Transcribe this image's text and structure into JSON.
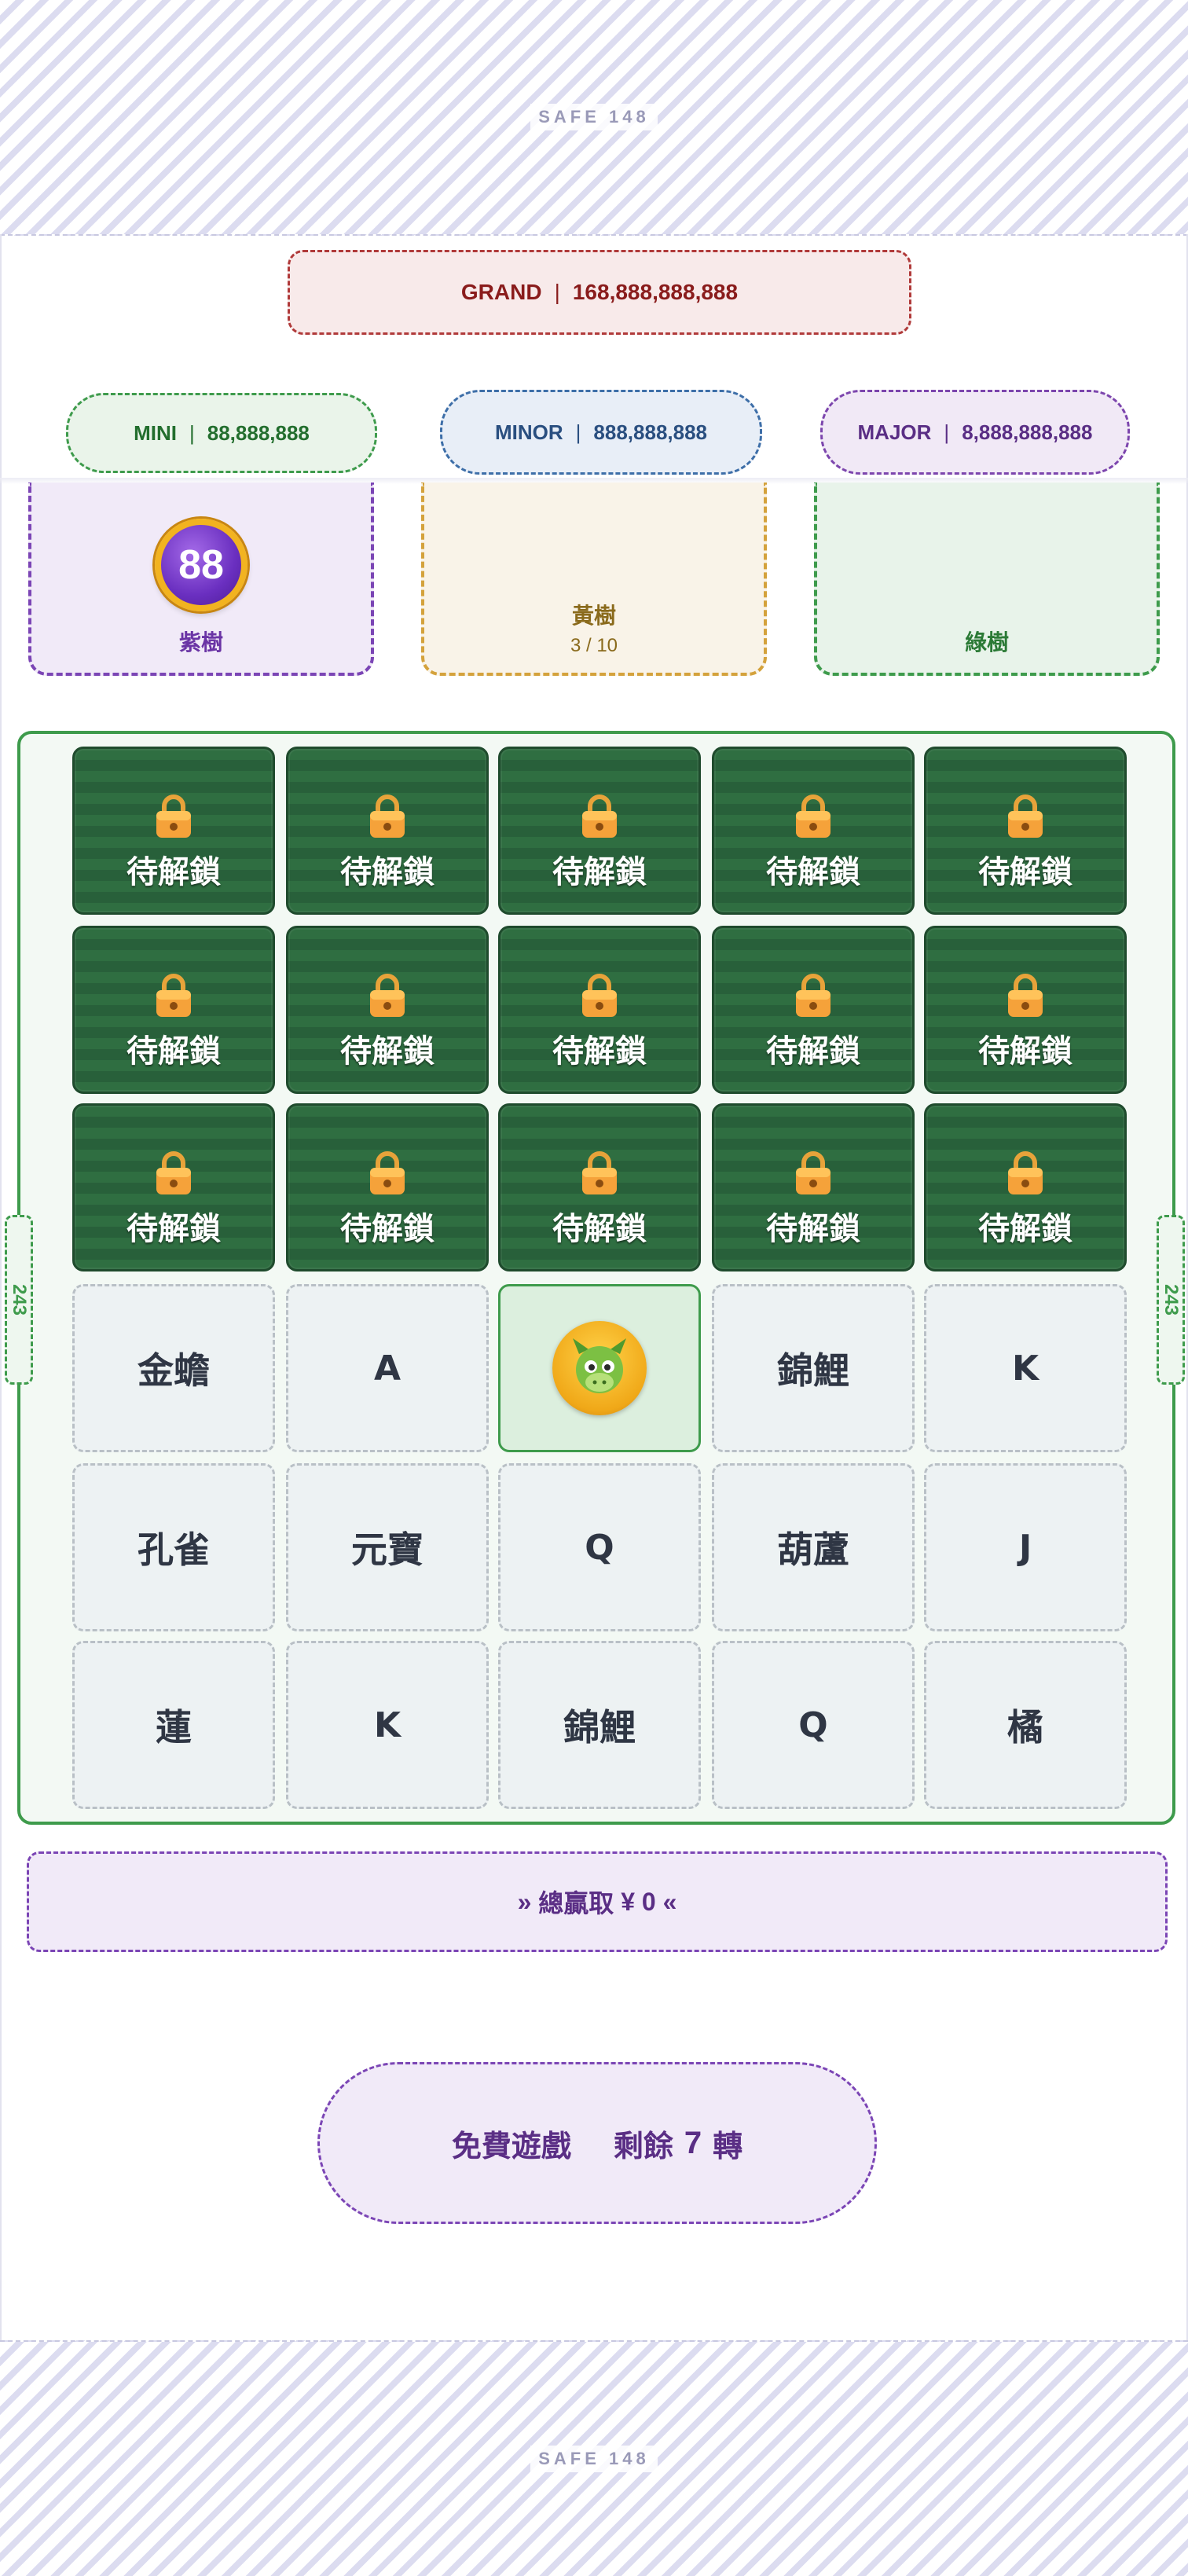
{
  "safe_area": {
    "top_label": "SAFE 148",
    "bottom_label": "SAFE 148"
  },
  "jackpots": {
    "grand": {
      "label": "GRAND",
      "value": "168,888,888,888"
    },
    "mini": {
      "label": "MINI",
      "value": "88,888,888"
    },
    "minor": {
      "label": "MINOR",
      "value": "888,888,888"
    },
    "major": {
      "label": "MAJOR",
      "value": "8,888,888,888"
    },
    "separator": "|"
  },
  "trees": [
    {
      "name": "紫樹",
      "badge": "88",
      "color": "#7b45b5"
    },
    {
      "name": "黃樹",
      "progress": "3 / 10",
      "color": "#d4a23c"
    },
    {
      "name": "綠樹",
      "color": "#3e9b4c"
    }
  ],
  "board": {
    "side_label": "243",
    "locked_label": "待解鎖",
    "rows": [
      [
        "待解鎖",
        "待解鎖",
        "待解鎖",
        "待解鎖",
        "待解鎖"
      ],
      [
        "待解鎖",
        "待解鎖",
        "待解鎖",
        "待解鎖",
        "待解鎖"
      ],
      [
        "待解鎖",
        "待解鎖",
        "待解鎖",
        "待解鎖",
        "待解鎖"
      ],
      [
        "金蟾",
        "A",
        "dragon-wild",
        "錦鯉",
        "K"
      ],
      [
        "孔雀",
        "元寶",
        "Q",
        "葫蘆",
        "J"
      ],
      [
        "蓮",
        "K",
        "錦鯉",
        "Q",
        "橘"
      ]
    ]
  },
  "win": {
    "prefix": "»",
    "label": "總贏取",
    "currency": "¥",
    "amount": "0",
    "suffix": "«"
  },
  "free_game": {
    "label": "免費遊戲",
    "remaining_prefix": "剩餘",
    "count": "7",
    "unit": "轉"
  },
  "colors": {
    "accent": "#7b45b5",
    "board": "#3e9b4c",
    "locked": "#2f6e41",
    "grand": "#b03a3a"
  }
}
